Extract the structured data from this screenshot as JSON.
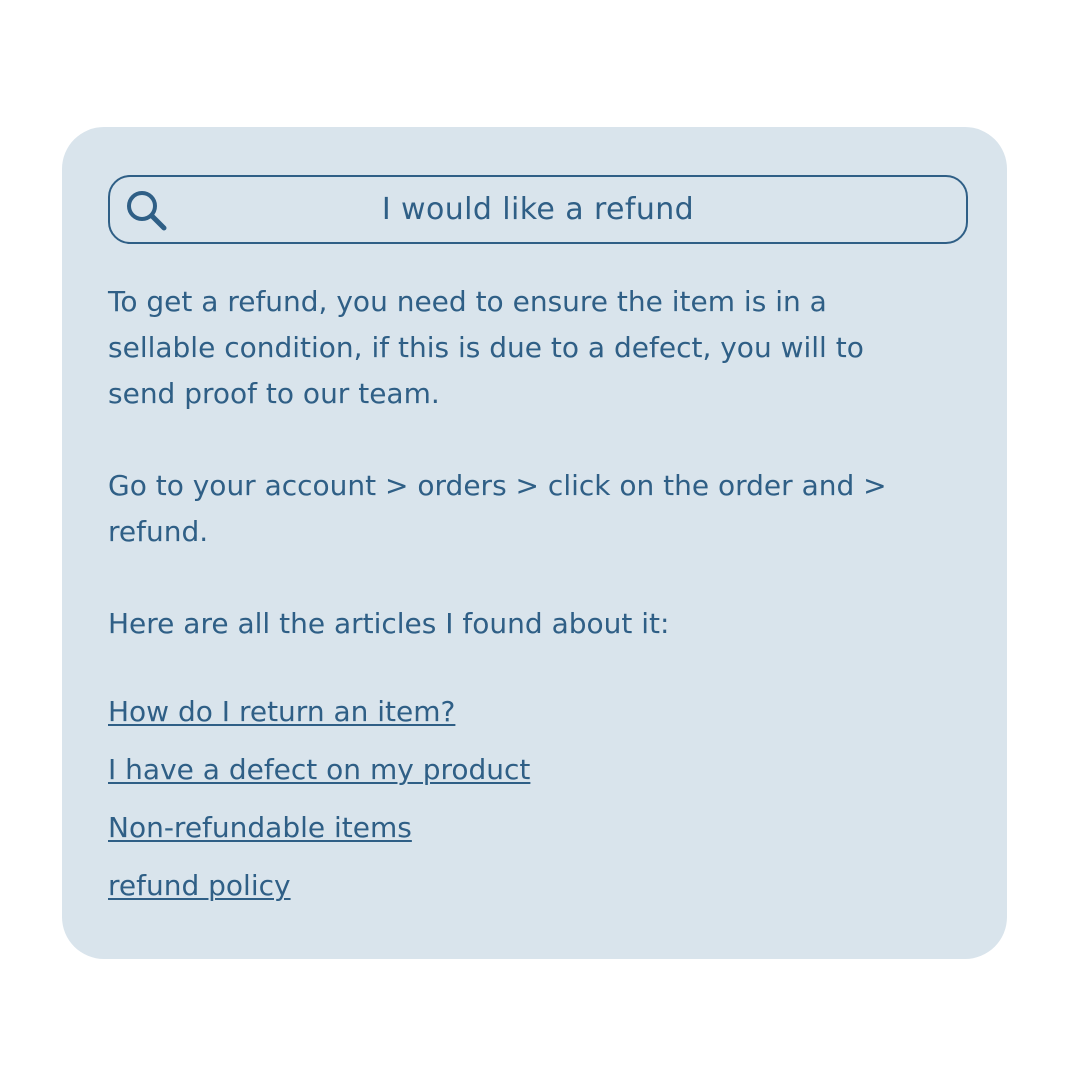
{
  "search": {
    "query": "I would like a refund",
    "icon": "search-icon"
  },
  "answer": {
    "paragraph_1": "To get a refund, you need to ensure the item is in a sellable condition, if this is due to a defect, you will to send proof to our team.",
    "paragraph_2": "Go to your account > orders > click on the order and > refund.",
    "paragraph_3": "Here are all the articles I found about it:"
  },
  "articles": [
    {
      "label": "How do I return an item?"
    },
    {
      "label": "I have a defect on my product"
    },
    {
      "label": "Non-refundable items"
    },
    {
      "label": "refund policy"
    }
  ],
  "colors": {
    "card_background": "#d9e4ec",
    "text": "#2f5f86",
    "page_background": "#ffffff"
  }
}
